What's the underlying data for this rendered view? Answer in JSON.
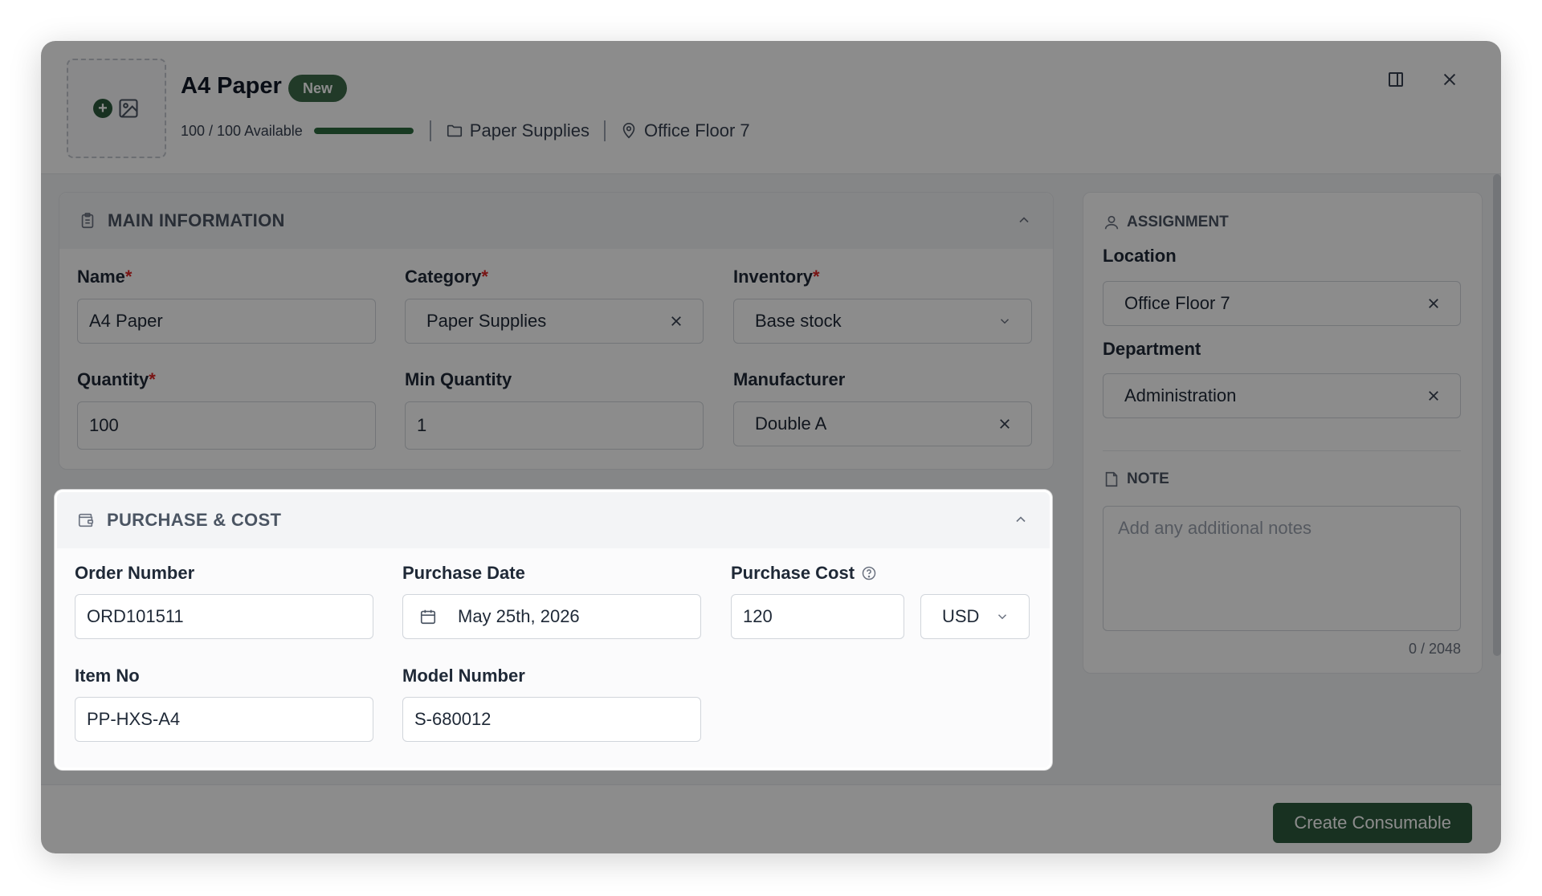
{
  "header": {
    "title": "A4 Paper",
    "badge": "New",
    "availability": "100 / 100 Available",
    "availability_fraction": 1.0,
    "category": "Paper Supplies",
    "location": "Office Floor 7"
  },
  "main_info": {
    "section_title": "MAIN INFORMATION",
    "name_label": "Name",
    "name_value": "A4 Paper",
    "category_label": "Category",
    "category_value": "Paper Supplies",
    "inventory_label": "Inventory",
    "inventory_value": "Base stock",
    "quantity_label": "Quantity",
    "quantity_value": "100",
    "min_quantity_label": "Min Quantity",
    "min_quantity_value": "1",
    "manufacturer_label": "Manufacturer",
    "manufacturer_value": "Double A",
    "required_mark": "*"
  },
  "purchase": {
    "section_title": "PURCHASE & COST",
    "order_number_label": "Order Number",
    "order_number_value": "ORD101511",
    "purchase_date_label": "Purchase Date",
    "purchase_date_value": "May 25th, 2026",
    "purchase_cost_label": "Purchase Cost",
    "purchase_cost_value": "120",
    "currency_value": "USD",
    "item_no_label": "Item No",
    "item_no_value": "PP-HXS-A4",
    "model_number_label": "Model Number",
    "model_number_value": "S-680012"
  },
  "assignment": {
    "section_title": "ASSIGNMENT",
    "location_label": "Location",
    "location_value": "Office Floor 7",
    "department_label": "Department",
    "department_value": "Administration"
  },
  "note": {
    "section_title": "NOTE",
    "placeholder": "Add any additional notes",
    "counter": "0 / 2048"
  },
  "footer": {
    "create_label": "Create Consumable"
  },
  "colors": {
    "brand": "#2d5a3d",
    "required": "#dc2626",
    "overlay": "rgba(0,0,0,0.45)"
  }
}
